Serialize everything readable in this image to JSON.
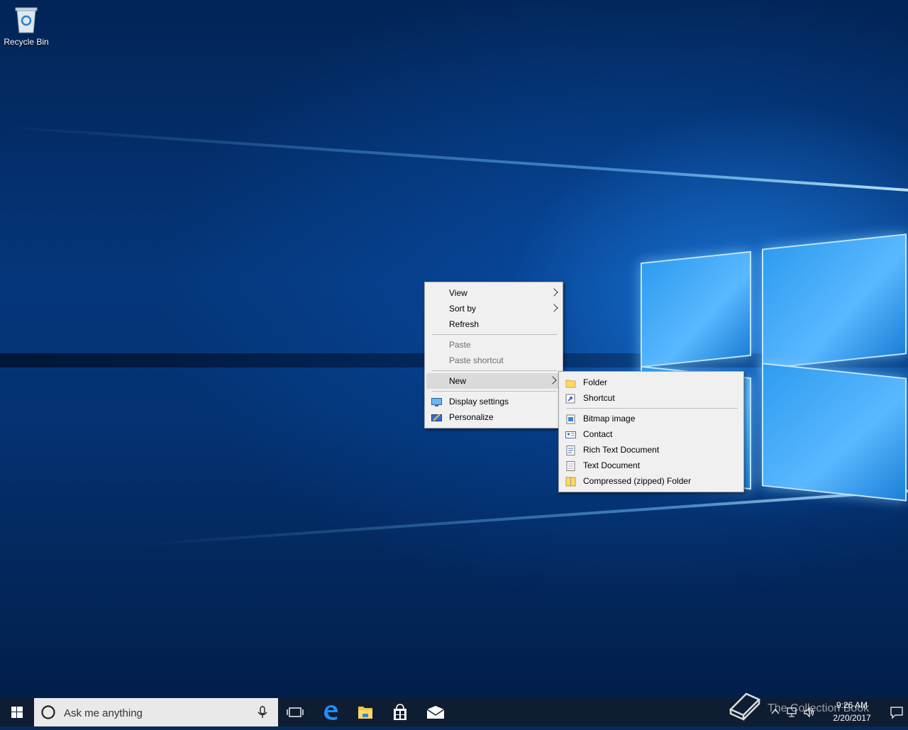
{
  "desktop": {
    "icons": [
      {
        "label": "Recycle Bin",
        "icon": "recycle-bin-icon"
      }
    ],
    "watermark": "The Collection Book"
  },
  "context_menu": {
    "items": [
      {
        "label": "View",
        "submenu": true
      },
      {
        "label": "Sort by",
        "submenu": true
      },
      {
        "label": "Refresh"
      },
      {
        "label": "Paste",
        "disabled": true
      },
      {
        "label": "Paste shortcut",
        "disabled": true
      },
      {
        "label": "New",
        "submenu": true,
        "highlighted": true
      },
      {
        "label": "Display settings",
        "icon": "display-settings-icon"
      },
      {
        "label": "Personalize",
        "icon": "personalize-icon"
      }
    ]
  },
  "new_submenu": {
    "items": [
      {
        "label": "Folder",
        "icon": "folder-icon"
      },
      {
        "label": "Shortcut",
        "icon": "shortcut-icon"
      },
      {
        "label": "Bitmap image",
        "icon": "bitmap-image-icon"
      },
      {
        "label": "Contact",
        "icon": "contact-icon"
      },
      {
        "label": "Rich Text Document",
        "icon": "rich-text-document-icon"
      },
      {
        "label": "Text Document",
        "icon": "text-document-icon"
      },
      {
        "label": "Compressed (zipped) Folder",
        "icon": "zipped-folder-icon"
      }
    ]
  },
  "taskbar": {
    "search_placeholder": "Ask me anything",
    "pinned": [
      "task-view-icon",
      "edge-icon",
      "file-explorer-icon",
      "store-icon",
      "mail-icon"
    ],
    "clock": {
      "time": "9:26 AM",
      "date": "2/20/2017"
    }
  },
  "colors": {
    "taskbar": "#0f1d33",
    "menu_bg": "#f0f0f0",
    "accent": "#0078d7"
  }
}
